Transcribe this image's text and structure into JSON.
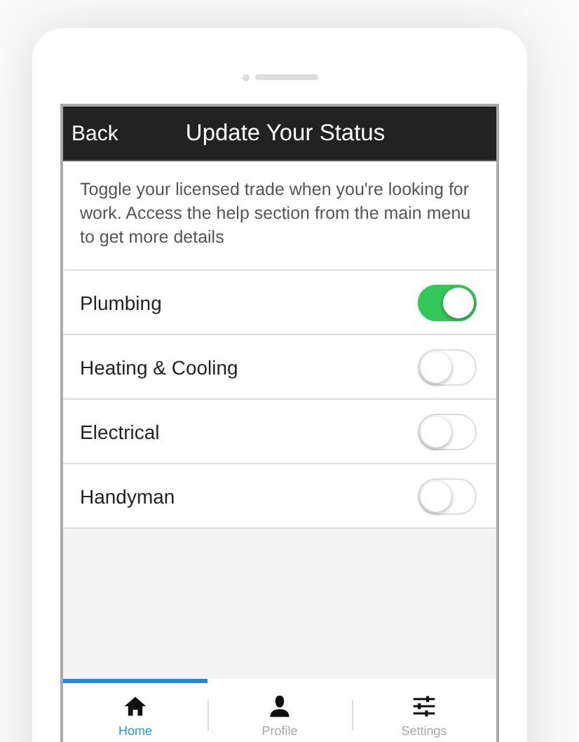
{
  "header": {
    "back": "Back",
    "title": "Update Your Status"
  },
  "description": "Toggle your licensed trade when you're looking for work. Access the help section from the main menu to get more details",
  "trades": [
    {
      "label": "Plumbing",
      "on": true
    },
    {
      "label": "Heating & Cooling",
      "on": false
    },
    {
      "label": "Electrical",
      "on": false
    },
    {
      "label": "Handyman",
      "on": false
    }
  ],
  "tabs": [
    {
      "label": "Home",
      "kind": "home",
      "selected": true
    },
    {
      "label": "Profile",
      "kind": "profile",
      "selected": false
    },
    {
      "label": "Settings",
      "kind": "settings",
      "selected": false
    }
  ]
}
